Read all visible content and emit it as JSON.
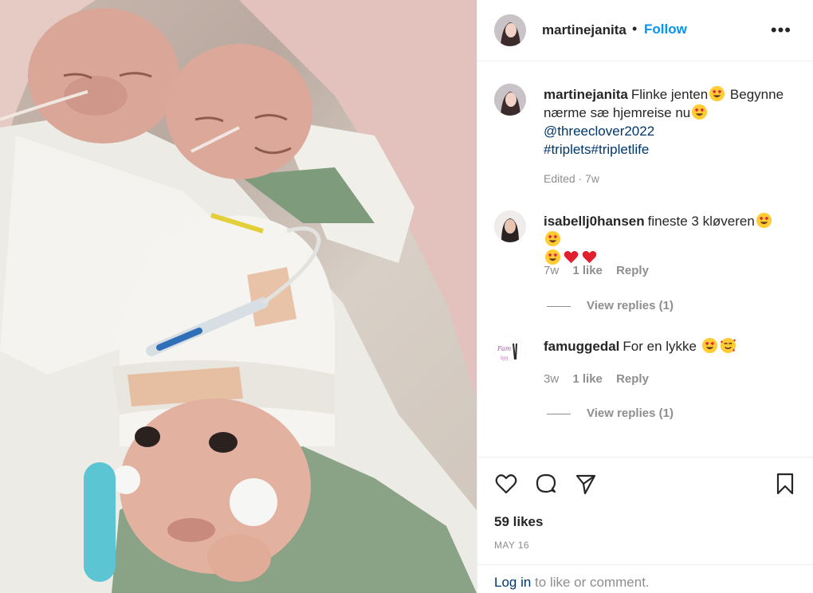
{
  "post": {
    "author": "martinejanita",
    "follow_label": "Follow",
    "separator": "•",
    "more_icon": "more-options-icon"
  },
  "caption": {
    "username": "martinejanita",
    "text_1": "Flinke jenten",
    "text_2": " Begynne nærme sæ hjemreise nu",
    "mention": "@threeclover2022",
    "hashtags": "#triplets#tripletlife",
    "meta": "Edited · 7w"
  },
  "comments": [
    {
      "username": "isabellj0hansen",
      "text": "fineste 3 kløveren",
      "time": "7w",
      "likes": "1 like",
      "reply": "Reply",
      "view_replies": "View replies (1)"
    },
    {
      "username": "famuggedal",
      "text": "For en lykke",
      "time": "3w",
      "likes": "1 like",
      "reply": "Reply",
      "view_replies": "View replies (1)"
    }
  ],
  "actions": {
    "icons": [
      "heart-icon",
      "comment-icon",
      "share-icon",
      "bookmark-icon"
    ],
    "likes": "59 likes",
    "date": "MAY 16"
  },
  "login": {
    "link": "Log in",
    "text": " to like or comment."
  },
  "colors": {
    "link_blue": "#0095f6",
    "link_dark": "#00376b",
    "muted": "#8e8e8e",
    "heart_red": "#ed4956",
    "emoji_yellow": "#ffcc33"
  }
}
